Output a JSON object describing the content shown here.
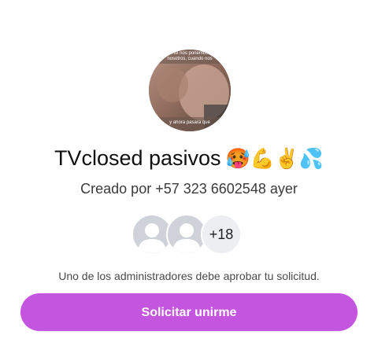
{
  "group": {
    "photo_caption_top": "Así nos ponemos nosotros, cuando nos dan duro",
    "photo_caption_bottom": "y ahora pasara que",
    "title": "TVclosed pasivos",
    "title_emojis": "🥵💪✌️💦",
    "created_by": "Creado por +57 323 6602548 ayer"
  },
  "members": {
    "extra_count": "+18",
    "avatar_icon": "person-silhouette-icon"
  },
  "join": {
    "approval_note": "Uno de los administradores debe aprobar tu solicitud.",
    "button_label": "Solicitar unirme"
  },
  "colors": {
    "button": "#c455de",
    "avatar_placeholder": "#cfd3d9",
    "badge_background": "#eceef1"
  }
}
